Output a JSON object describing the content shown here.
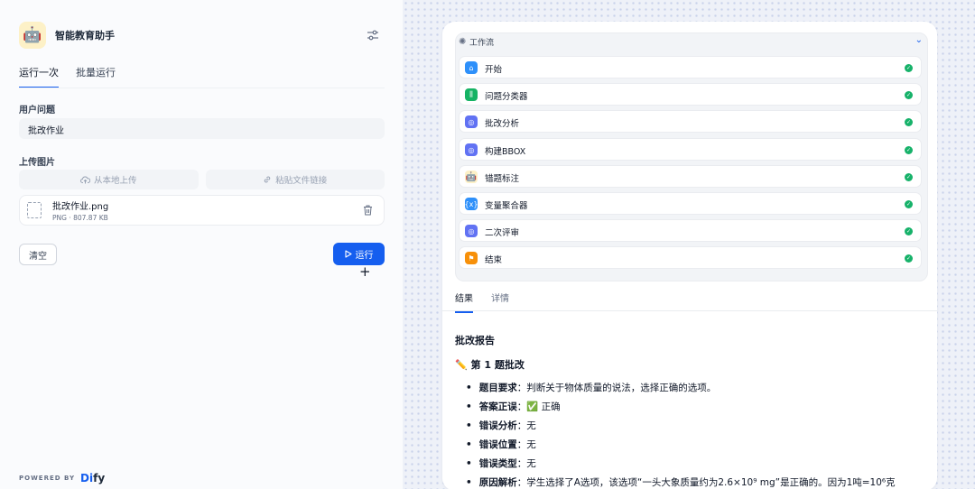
{
  "app": {
    "title": "智能教育助手",
    "avatar_emoji": "🤖"
  },
  "tabs": [
    {
      "label": "运行一次",
      "active": true
    },
    {
      "label": "批量运行",
      "active": false
    }
  ],
  "form": {
    "question_label": "用户问题",
    "question_value": "批改作业",
    "image_label": "上传图片",
    "upload_local": "从本地上传",
    "paste_link": "粘贴文件链接",
    "file_name": "批改作业.png",
    "file_meta": "PNG · 807.87 KB",
    "clear_label": "清空",
    "run_label": "运行"
  },
  "footer": {
    "powered_by": "POWERED BY",
    "brand_prefix": "D",
    "brand_mid": "i",
    "brand_suffix": "fy"
  },
  "workflow": {
    "title": "工作流",
    "nodes": [
      {
        "label": "开始",
        "color": "#2e90fa",
        "icon": "home-icon"
      },
      {
        "label": "问题分类器",
        "color": "#16b364",
        "icon": "classifier-icon"
      },
      {
        "label": "批改分析",
        "color": "#6172f3",
        "icon": "llm-icon"
      },
      {
        "label": "构建BBOX",
        "color": "#6172f3",
        "icon": "llm-icon"
      },
      {
        "label": "错题标注",
        "color": "#fdf1c7",
        "icon": "robot-icon"
      },
      {
        "label": "变量聚合器",
        "color": "#2e90fa",
        "icon": "variable-icon"
      },
      {
        "label": "二次评审",
        "color": "#6172f3",
        "icon": "llm-icon"
      },
      {
        "label": "结束",
        "color": "#f79009",
        "icon": "end-icon"
      }
    ]
  },
  "result_tabs": [
    {
      "label": "结果",
      "active": true
    },
    {
      "label": "详情",
      "active": false
    }
  ],
  "report": {
    "title": "批改报告",
    "question_title": "✏️ 第 1 题批改",
    "items": [
      {
        "key": "题目要求",
        "value": "：判断关于物体质量的说法，选择正确的选项。"
      },
      {
        "key": "答案正误",
        "value": "：✅ 正确"
      },
      {
        "key": "错误分析",
        "value": "：无"
      },
      {
        "key": "错误位置",
        "value": "：无"
      },
      {
        "key": "错误类型",
        "value": "：无"
      },
      {
        "key": "原因解析",
        "value": "：学生选择了A选项，该选项“一头大象质量约为2.6×10⁹ mg”是正确的。因为1吨=10⁶克"
      }
    ]
  }
}
